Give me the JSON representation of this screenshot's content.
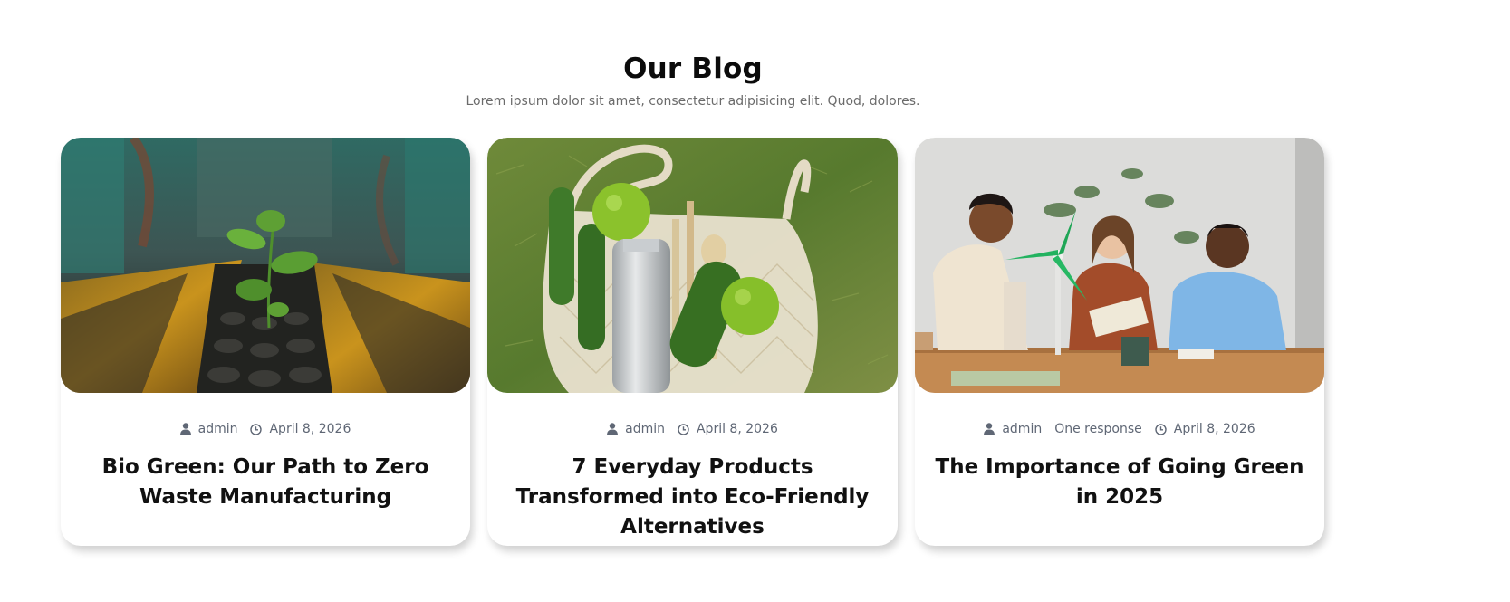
{
  "section": {
    "title": "Our Blog",
    "subtitle": "Lorem ipsum dolor sit amet, consectetur adipisicing elit. Quod, dolores."
  },
  "posts": [
    {
      "author": "admin",
      "date": "April 8, 2026",
      "title": "Bio Green: Our Path to Zero Waste Manufacturing",
      "image": "sprout-growing-between-rusty-rails"
    },
    {
      "author": "admin",
      "date": "April 8, 2026",
      "title": "7 Everyday Products Transformed into Eco-Friendly Alternatives",
      "image": "mesh-bag-with-cucumbers-apples-bottle-on-grass"
    },
    {
      "author": "admin",
      "responses": "One response",
      "date": "April 8, 2026",
      "title": "The Importance of Going Green in 2025",
      "image": "three-people-with-wind-turbine-model"
    }
  ],
  "icons": {
    "author": "user-icon",
    "date": "clock-icon"
  },
  "colors": {
    "meta": "#5f6775",
    "title": "#111111",
    "subtitle": "#6b6b6b"
  }
}
